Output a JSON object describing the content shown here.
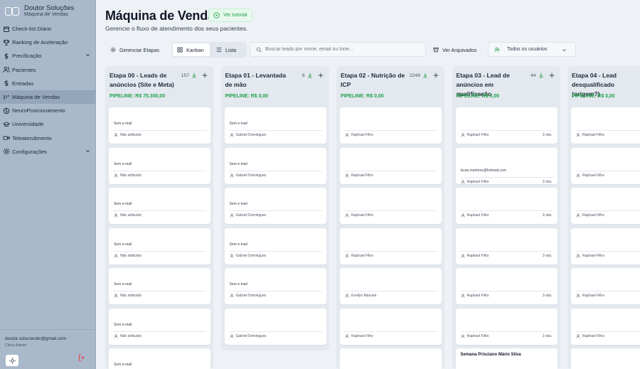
{
  "brand": {
    "name": "Doutor Soluções",
    "subtitle": "Máquina de Vendas"
  },
  "nav": [
    {
      "label": "Check-list Diário",
      "icon": "calendar-icon",
      "active": false
    },
    {
      "label": "Ranking de Aceleração",
      "icon": "trophy-icon",
      "active": false
    },
    {
      "label": "Precificação",
      "icon": "dollar-icon",
      "active": false,
      "chevron": true
    },
    {
      "label": "Pacientes",
      "icon": "users-icon",
      "active": false
    },
    {
      "label": "Entradas",
      "icon": "dollar-icon",
      "active": false
    },
    {
      "label": "Máquina de Vendas",
      "icon": "kanban-icon",
      "active": true
    },
    {
      "label": "NeuroPosicionamento",
      "icon": "brain-icon",
      "active": false
    },
    {
      "label": "Universidade",
      "icon": "graduation-cap-icon",
      "active": false
    },
    {
      "label": "Teleatendimento",
      "icon": "video-icon",
      "active": false
    },
    {
      "label": "Configurações",
      "icon": "gear-icon",
      "active": false,
      "chevron": true
    }
  ],
  "user": {
    "email": "doutor.solucoesbr@gmail.com",
    "role": "Clinic Admin"
  },
  "page": {
    "title": "Máquina de Vendas",
    "tutorial": "Ver tutorial",
    "subtitle": "Gerencie o fluxo de atendimento dos seus pacientes."
  },
  "toolbar": {
    "manage": "Gerenciar Etapas",
    "kanban": "Kanban",
    "list": "Lista",
    "search_placeholder": "Buscar leads por nome, email ou fone...",
    "archived": "Ver Arquivados",
    "users": "Todos os usuários"
  },
  "colors": {
    "accent": "#22a04b",
    "sidebar": "#a9b9cb"
  },
  "columns": [
    {
      "title": "Etapa 00 - Leads de anúncios (Site e Meta)",
      "count": "157",
      "pipeline": "PIPELINE: R$ 75.300,00",
      "cards": [
        {
          "email": "Sem e-mail",
          "owner": "Não atribuído"
        },
        {
          "email": "Sem e-mail",
          "owner": "Não atribuído"
        },
        {
          "email": "Sem e-mail",
          "owner": "Não atribuído"
        },
        {
          "email": "Sem e-mail",
          "owner": "Não atribuído"
        },
        {
          "email": "Sem e-mail",
          "owner": "Não atribuído"
        },
        {
          "email": "Sem e-mail",
          "owner": "Não atribuído"
        },
        {
          "email": "Sem e-mail",
          "owner": ""
        }
      ]
    },
    {
      "title": "Etapa 01 - Levantada de mão",
      "count": "6",
      "pipeline": "PIPELINE: R$ 0,00",
      "cards": [
        {
          "email": "Sem e-mail",
          "owner": "Gabriel Domingues"
        },
        {
          "email": "Sem e-mail",
          "owner": "Gabriel Domingues"
        },
        {
          "email": "Sem e-mail",
          "owner": "Gabriel Domingues"
        },
        {
          "email": "Sem e-mail",
          "owner": "Gabriel Domingues"
        },
        {
          "email": "Sem e-mail",
          "owner": "Gabriel Domingues"
        },
        {
          "email": "",
          "owner": "Gabriel Domingues"
        }
      ]
    },
    {
      "title": "Etapa 02 - Nutrição de ICP",
      "count": "2248",
      "pipeline": "PIPELINE: R$ 0,00",
      "cards": [
        {
          "email": "",
          "owner": "Raphael Filho"
        },
        {
          "email": "",
          "owner": "Raphael Filho"
        },
        {
          "email": "",
          "owner": "Raphael Filho"
        },
        {
          "email": "",
          "owner": "Raphael Filho"
        },
        {
          "email": "",
          "owner": "Evellyn Marcela"
        },
        {
          "email": "",
          "owner": "Raphael Filho"
        },
        {
          "email": "",
          "owner": ""
        }
      ]
    },
    {
      "title": "Etapa 03 - Lead de anúncios em qualificação",
      "count": "44",
      "pipeline": "PIPELINE: R$ 0,00",
      "cards": [
        {
          "email": "",
          "owner": "Raphael Filho",
          "obs": "3 obs."
        },
        {
          "email": "lucas.martinez@hotmail.com",
          "owner": "Raphael Filho",
          "obs": "3 obs."
        },
        {
          "email": "",
          "owner": "Raphael Filho",
          "obs": "3 obs."
        },
        {
          "email": "",
          "owner": "Raphael Filho",
          "obs": "3 obs."
        },
        {
          "email": "",
          "owner": "Raphael Filho",
          "obs": "3 obs."
        },
        {
          "email": "",
          "owner": "Raphael Filho",
          "obs": "2 obs."
        },
        {
          "email": "",
          "owner": "",
          "name": "Semana Prisciano Mário Silva"
        }
      ]
    },
    {
      "title": "Etapa 04 - Lead desqualificado (origem?)",
      "count": "",
      "pipeline": "PIPELINE: R$ 0,00",
      "cards": [
        {
          "email": "",
          "owner": "Raphael Filho"
        },
        {
          "email": "",
          "owner": "Raphael Filho"
        },
        {
          "email": "",
          "owner": "Raphael Filho"
        },
        {
          "email": "",
          "owner": "Raphael Filho"
        },
        {
          "email": "",
          "owner": "Raphael Filho"
        },
        {
          "email": "",
          "owner": "Raphael Filho"
        },
        {
          "email": "",
          "owner": ""
        }
      ]
    }
  ]
}
